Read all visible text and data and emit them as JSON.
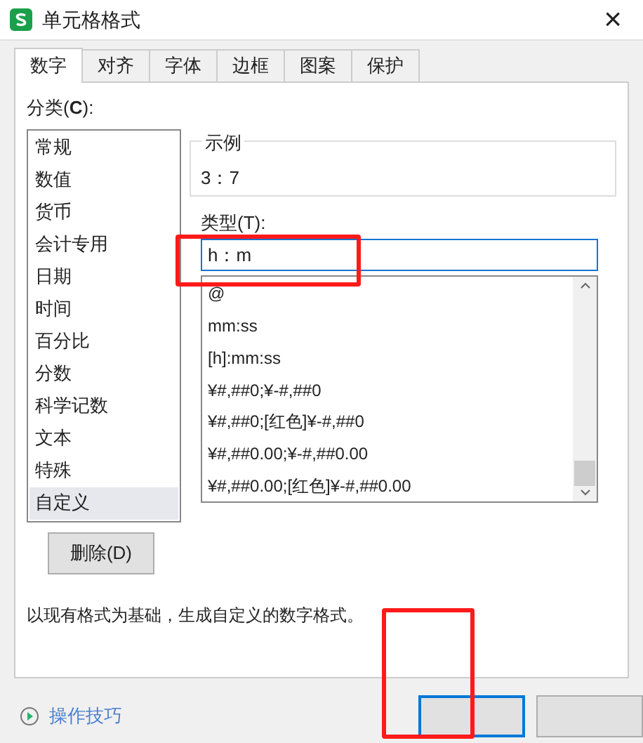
{
  "window": {
    "title": "单元格格式",
    "close": "×"
  },
  "tabs": [
    {
      "label": "数字",
      "selected": true
    },
    {
      "label": "对齐",
      "selected": false
    },
    {
      "label": "字体",
      "selected": false
    },
    {
      "label": "边框",
      "selected": false
    },
    {
      "label": "图案",
      "selected": false
    },
    {
      "label": "保护",
      "selected": false
    }
  ],
  "category": {
    "label": "分类(**C**):",
    "items": [
      {
        "label": "常规",
        "selected": false
      },
      {
        "label": "数值",
        "selected": false
      },
      {
        "label": "货币",
        "selected": false
      },
      {
        "label": "会计专用",
        "selected": false
      },
      {
        "label": "日期",
        "selected": false
      },
      {
        "label": "时间",
        "selected": false
      },
      {
        "label": "百分比",
        "selected": false
      },
      {
        "label": "分数",
        "selected": false
      },
      {
        "label": "科学记数",
        "selected": false
      },
      {
        "label": "文本",
        "selected": false
      },
      {
        "label": "特殊",
        "selected": false
      },
      {
        "label": "自定义",
        "selected": true
      }
    ]
  },
  "sample": {
    "label": "示例",
    "value": "3：7"
  },
  "type": {
    "label": "类型(T):",
    "value": "h：m",
    "highlighted": true,
    "items": [
      {
        "label": "@"
      },
      {
        "label": "mm:ss"
      },
      {
        "label": "[h]:mm:ss"
      },
      {
        "label": "¥#,##0;¥-#,##0"
      },
      {
        "label": "¥#,##0;[红色]¥-#,##0"
      },
      {
        "label": "¥#,##0.00;¥-#,##0.00"
      },
      {
        "label": "¥#,##0.00;[红色]¥-#,##0.00"
      }
    ]
  },
  "delete_button": "删除(D)",
  "description": "以现有格式为基础，生成自定义的数字格式。",
  "tips_link": "操作技巧",
  "footer_buttons": [
    {
      "kind": "primary",
      "highlighted": true
    },
    {
      "kind": "secondary",
      "highlighted": false
    }
  ]
}
